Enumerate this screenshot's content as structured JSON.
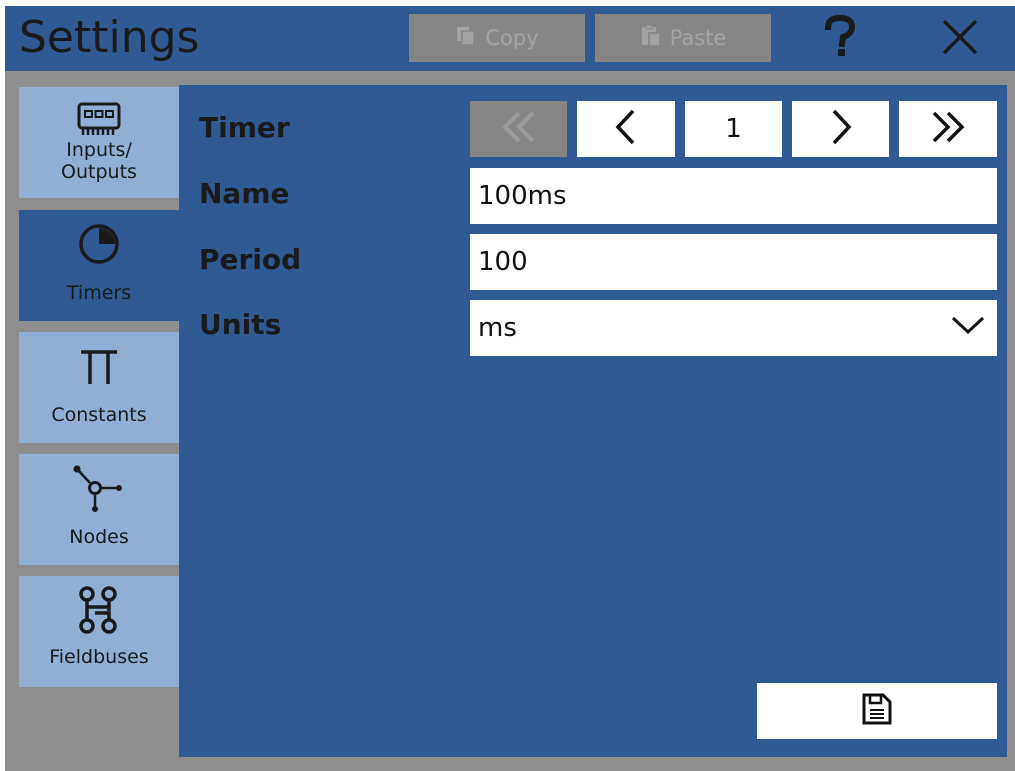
{
  "header": {
    "title": "Settings",
    "copy_label": "Copy",
    "paste_label": "Paste"
  },
  "sidebar": {
    "items": [
      {
        "label_line1": "Inputs/",
        "label_line2": "Outputs",
        "icon": "io-module-icon"
      },
      {
        "label": "Timers",
        "icon": "timer-icon",
        "active": true
      },
      {
        "label": "Constants",
        "icon": "pi-icon"
      },
      {
        "label": "Nodes",
        "icon": "nodes-icon"
      },
      {
        "label": "Fieldbuses",
        "icon": "fieldbus-icon"
      }
    ]
  },
  "form": {
    "timer_label": "Timer",
    "timer_index": "1",
    "name_label": "Name",
    "name_value": "100ms",
    "period_label": "Period",
    "period_value": "100",
    "units_label": "Units",
    "units_value": "ms"
  },
  "colors": {
    "panel": "#2f5a93",
    "sidebar_item": "#91afd5",
    "disabled": "#858585",
    "background": "#8e8e8e"
  }
}
